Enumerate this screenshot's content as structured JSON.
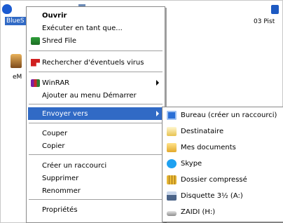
{
  "desktop": {
    "left_label": "BlueS",
    "em_label": "eM",
    "right_label": "03 Pist"
  },
  "context_menu": {
    "items": [
      {
        "label": "Ouvrir"
      },
      {
        "label": "Exécuter en tant que..."
      },
      {
        "label": "Shred File",
        "icon": "shred-icon"
      },
      {
        "label": "Rechercher d'éventuels virus",
        "icon": "virus-scan-icon"
      },
      {
        "label": "WinRAR",
        "icon": "winrar-icon"
      },
      {
        "label": "Ajouter au menu Démarrer"
      },
      {
        "label": "Envoyer vers"
      },
      {
        "label": "Couper"
      },
      {
        "label": "Copier"
      },
      {
        "label": "Créer un raccourci"
      },
      {
        "label": "Supprimer"
      },
      {
        "label": "Renommer"
      },
      {
        "label": "Propriétés"
      }
    ],
    "highlight_color": "#316ac5"
  },
  "send_to_menu": {
    "items": [
      {
        "label": "Bureau (créer un raccourci)",
        "icon": "desktop-icon"
      },
      {
        "label": "Destinataire",
        "icon": "mail-recipient-icon"
      },
      {
        "label": "Mes documents",
        "icon": "my-documents-icon"
      },
      {
        "label": "Skype",
        "icon": "skype-icon"
      },
      {
        "label": "Dossier compressé",
        "icon": "zip-folder-icon"
      },
      {
        "label": "Disquette 3½ (A:)",
        "icon": "floppy-icon"
      },
      {
        "label": "ZAIDI (H:)",
        "icon": "drive-icon"
      }
    ]
  }
}
